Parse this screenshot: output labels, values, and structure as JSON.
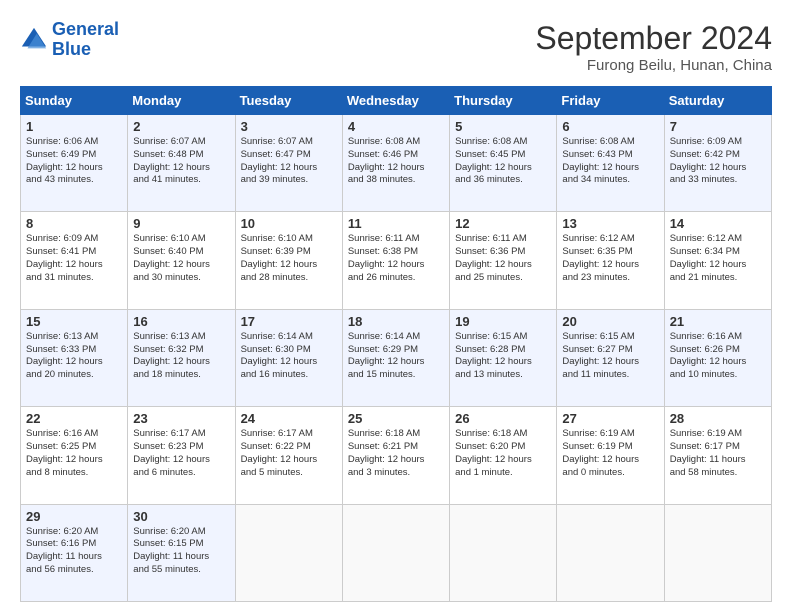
{
  "header": {
    "logo_line1": "General",
    "logo_line2": "Blue",
    "month_title": "September 2024",
    "location": "Furong Beilu, Hunan, China"
  },
  "days_of_week": [
    "Sunday",
    "Monday",
    "Tuesday",
    "Wednesday",
    "Thursday",
    "Friday",
    "Saturday"
  ],
  "weeks": [
    [
      {
        "day": "1",
        "text": "Sunrise: 6:06 AM\nSunset: 6:49 PM\nDaylight: 12 hours\nand 43 minutes."
      },
      {
        "day": "2",
        "text": "Sunrise: 6:07 AM\nSunset: 6:48 PM\nDaylight: 12 hours\nand 41 minutes."
      },
      {
        "day": "3",
        "text": "Sunrise: 6:07 AM\nSunset: 6:47 PM\nDaylight: 12 hours\nand 39 minutes."
      },
      {
        "day": "4",
        "text": "Sunrise: 6:08 AM\nSunset: 6:46 PM\nDaylight: 12 hours\nand 38 minutes."
      },
      {
        "day": "5",
        "text": "Sunrise: 6:08 AM\nSunset: 6:45 PM\nDaylight: 12 hours\nand 36 minutes."
      },
      {
        "day": "6",
        "text": "Sunrise: 6:08 AM\nSunset: 6:43 PM\nDaylight: 12 hours\nand 34 minutes."
      },
      {
        "day": "7",
        "text": "Sunrise: 6:09 AM\nSunset: 6:42 PM\nDaylight: 12 hours\nand 33 minutes."
      }
    ],
    [
      {
        "day": "8",
        "text": "Sunrise: 6:09 AM\nSunset: 6:41 PM\nDaylight: 12 hours\nand 31 minutes."
      },
      {
        "day": "9",
        "text": "Sunrise: 6:10 AM\nSunset: 6:40 PM\nDaylight: 12 hours\nand 30 minutes."
      },
      {
        "day": "10",
        "text": "Sunrise: 6:10 AM\nSunset: 6:39 PM\nDaylight: 12 hours\nand 28 minutes."
      },
      {
        "day": "11",
        "text": "Sunrise: 6:11 AM\nSunset: 6:38 PM\nDaylight: 12 hours\nand 26 minutes."
      },
      {
        "day": "12",
        "text": "Sunrise: 6:11 AM\nSunset: 6:36 PM\nDaylight: 12 hours\nand 25 minutes."
      },
      {
        "day": "13",
        "text": "Sunrise: 6:12 AM\nSunset: 6:35 PM\nDaylight: 12 hours\nand 23 minutes."
      },
      {
        "day": "14",
        "text": "Sunrise: 6:12 AM\nSunset: 6:34 PM\nDaylight: 12 hours\nand 21 minutes."
      }
    ],
    [
      {
        "day": "15",
        "text": "Sunrise: 6:13 AM\nSunset: 6:33 PM\nDaylight: 12 hours\nand 20 minutes."
      },
      {
        "day": "16",
        "text": "Sunrise: 6:13 AM\nSunset: 6:32 PM\nDaylight: 12 hours\nand 18 minutes."
      },
      {
        "day": "17",
        "text": "Sunrise: 6:14 AM\nSunset: 6:30 PM\nDaylight: 12 hours\nand 16 minutes."
      },
      {
        "day": "18",
        "text": "Sunrise: 6:14 AM\nSunset: 6:29 PM\nDaylight: 12 hours\nand 15 minutes."
      },
      {
        "day": "19",
        "text": "Sunrise: 6:15 AM\nSunset: 6:28 PM\nDaylight: 12 hours\nand 13 minutes."
      },
      {
        "day": "20",
        "text": "Sunrise: 6:15 AM\nSunset: 6:27 PM\nDaylight: 12 hours\nand 11 minutes."
      },
      {
        "day": "21",
        "text": "Sunrise: 6:16 AM\nSunset: 6:26 PM\nDaylight: 12 hours\nand 10 minutes."
      }
    ],
    [
      {
        "day": "22",
        "text": "Sunrise: 6:16 AM\nSunset: 6:25 PM\nDaylight: 12 hours\nand 8 minutes."
      },
      {
        "day": "23",
        "text": "Sunrise: 6:17 AM\nSunset: 6:23 PM\nDaylight: 12 hours\nand 6 minutes."
      },
      {
        "day": "24",
        "text": "Sunrise: 6:17 AM\nSunset: 6:22 PM\nDaylight: 12 hours\nand 5 minutes."
      },
      {
        "day": "25",
        "text": "Sunrise: 6:18 AM\nSunset: 6:21 PM\nDaylight: 12 hours\nand 3 minutes."
      },
      {
        "day": "26",
        "text": "Sunrise: 6:18 AM\nSunset: 6:20 PM\nDaylight: 12 hours\nand 1 minute."
      },
      {
        "day": "27",
        "text": "Sunrise: 6:19 AM\nSunset: 6:19 PM\nDaylight: 12 hours\nand 0 minutes."
      },
      {
        "day": "28",
        "text": "Sunrise: 6:19 AM\nSunset: 6:17 PM\nDaylight: 11 hours\nand 58 minutes."
      }
    ],
    [
      {
        "day": "29",
        "text": "Sunrise: 6:20 AM\nSunset: 6:16 PM\nDaylight: 11 hours\nand 56 minutes."
      },
      {
        "day": "30",
        "text": "Sunrise: 6:20 AM\nSunset: 6:15 PM\nDaylight: 11 hours\nand 55 minutes."
      },
      {
        "day": "",
        "text": ""
      },
      {
        "day": "",
        "text": ""
      },
      {
        "day": "",
        "text": ""
      },
      {
        "day": "",
        "text": ""
      },
      {
        "day": "",
        "text": ""
      }
    ]
  ]
}
